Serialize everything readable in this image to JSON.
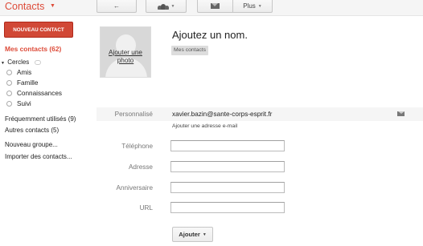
{
  "header": {
    "app_title": "Contacts",
    "toolbar": {
      "back_icon": "←",
      "plus_label": "Plus"
    }
  },
  "sidebar": {
    "new_contact_label": "NOUVEAU CONTACT",
    "my_contacts": "Mes contacts (62)",
    "circles": {
      "label": "Cercles",
      "items": [
        "Amis",
        "Famille",
        "Connaissances",
        "Suivi"
      ]
    },
    "frequent": "Fréquemment utilisés (9)",
    "other_contacts": "Autres contacts (5)",
    "new_group": "Nouveau groupe...",
    "import": "Importer des contacts..."
  },
  "contact": {
    "photo_link": "Ajouter une photo",
    "name_placeholder": "Ajoutez un nom.",
    "group_chip": "Mes contacts",
    "email_label": "Personnalisé",
    "email_value": "xavier.bazin@sante-corps-esprit.fr",
    "add_email_link": "Ajouter une adresse e-mail",
    "fields": {
      "phone_label": "Téléphone",
      "address_label": "Adresse",
      "anniversary_label": "Anniversaire",
      "url_label": "URL"
    },
    "add_button": "Ajouter"
  }
}
